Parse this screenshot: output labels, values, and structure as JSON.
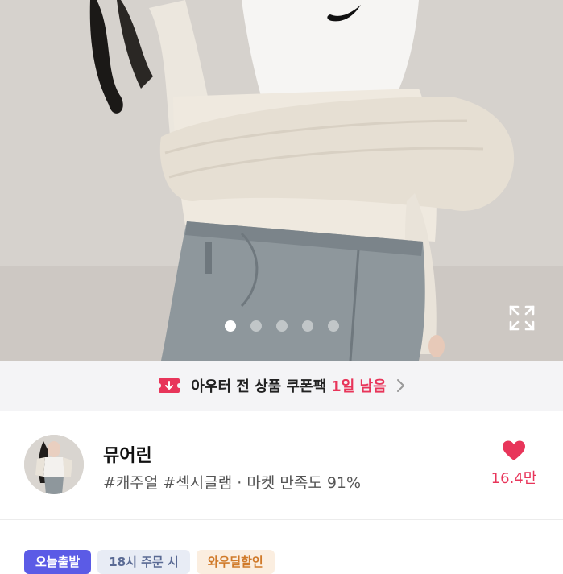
{
  "hero": {
    "image_alt": "",
    "pager": {
      "count": 5,
      "active_index": 0
    },
    "expand_icon": "expand-icon"
  },
  "coupon_banner": {
    "icon": "coupon-icon",
    "text": "아우터 전 상품 쿠폰팩",
    "highlight": "1일 남음",
    "chevron_icon": "chevron-right-icon",
    "accent_color": "#e8355a"
  },
  "shop": {
    "name": "뮤어린",
    "meta": "#캐주얼 #섹시글램 · 마켓 만족도 91%",
    "like": {
      "icon": "heart-icon",
      "count": "16.4만",
      "color": "#e8355a"
    }
  },
  "badges": [
    {
      "label": "오늘출발"
    },
    {
      "label": "18시 주문 시"
    },
    {
      "label": "와우딜할인"
    }
  ]
}
